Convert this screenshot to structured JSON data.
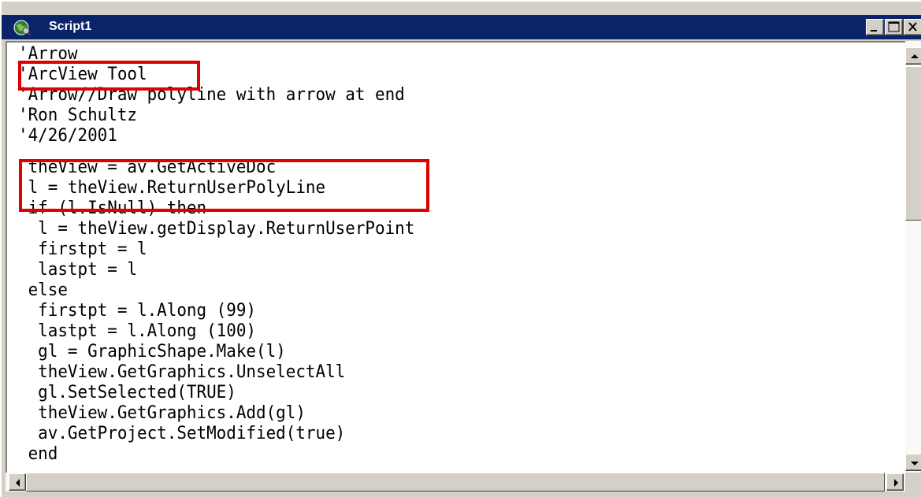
{
  "window": {
    "title": "Script1",
    "icon": "arcview-globe-icon"
  },
  "editor": {
    "lines": [
      "'Arrow",
      "'ArcView Tool",
      "'Arrow//Draw polyline with arrow at end",
      "'Ron Schultz",
      "'4/26/2001",
      "",
      " theView = av.GetActiveDoc",
      " l = theView.ReturnUserPolyLine",
      " if (l.IsNull) then",
      "  l = theView.getDisplay.ReturnUserPoint",
      "  firstpt = l",
      "  lastpt = l",
      " else",
      "  firstpt = l.Along (99)",
      "  lastpt = l.Along (100)",
      "  gl = GraphicShape.Make(l)",
      "  theView.GetGraphics.UnselectAll",
      "  gl.SetSelected(TRUE)",
      "  theView.GetGraphics.Add(gl)",
      "  av.GetProject.SetModified(true)",
      " end"
    ],
    "highlight_color": "#e00000"
  },
  "colors": {
    "titlebar": "#0a246a",
    "chrome": "#d4d0c8",
    "editor_bg": "#ffffff"
  }
}
